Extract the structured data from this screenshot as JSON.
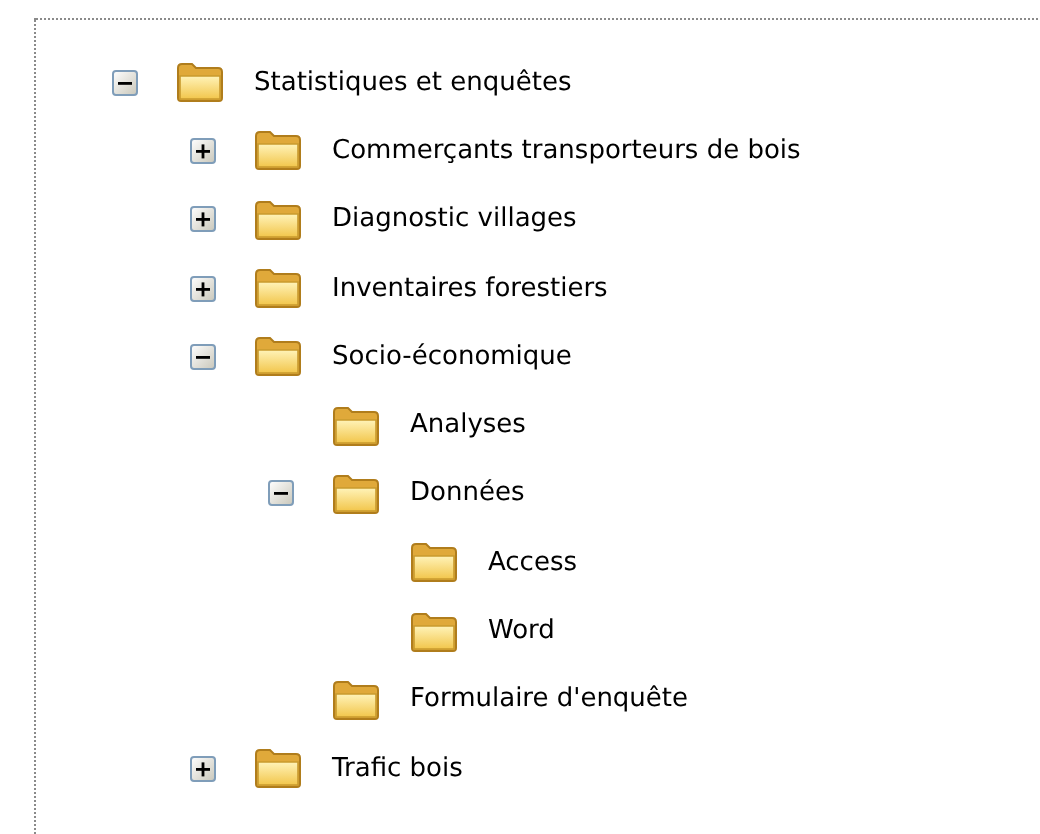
{
  "tree": [
    {
      "label": "Statistiques et enquêtes",
      "expanded": true,
      "children": [
        {
          "label": "Commerçants transporteurs de bois",
          "expanded": false
        },
        {
          "label": "Diagnostic villages",
          "expanded": false
        },
        {
          "label": "Inventaires forestiers",
          "expanded": false
        },
        {
          "label": "Socio-économique",
          "expanded": true,
          "children": [
            {
              "label": "Analyses"
            },
            {
              "label": "Données",
              "expanded": true,
              "children": [
                {
                  "label": "Access"
                },
                {
                  "label": "Word"
                }
              ]
            },
            {
              "label": "Formulaire d'enquête"
            }
          ]
        },
        {
          "label": "Trafic bois",
          "expanded": false
        }
      ]
    }
  ]
}
